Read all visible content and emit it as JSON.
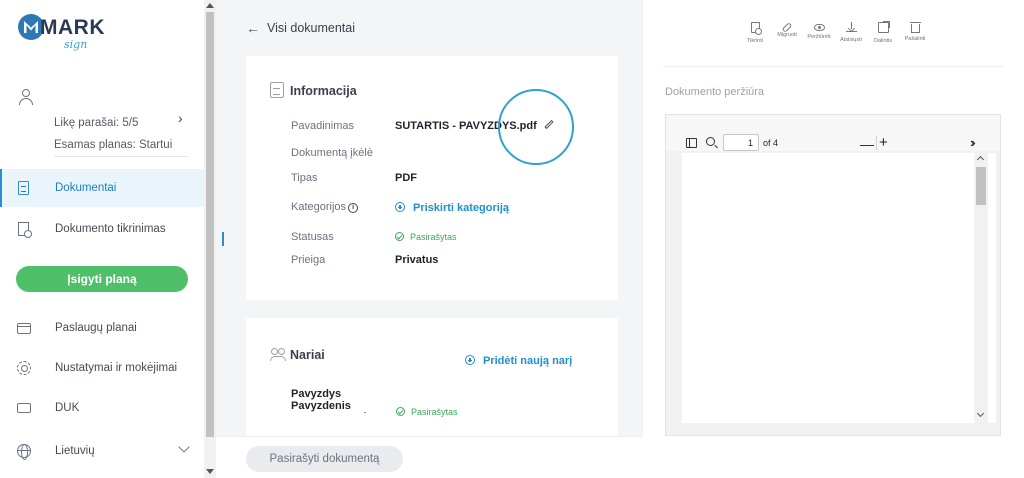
{
  "brand": {
    "word": "MARK",
    "sub": "sign"
  },
  "account": {
    "signatures_left": "Likę parašai: 5/5",
    "current_plan": "Esamas planas: Startui"
  },
  "nav": {
    "documents": "Dokumentai",
    "doc_check": "Dokumento tikrinimas",
    "buy_plan": "Įsigyti planą",
    "service_plans": "Paslaugų planai",
    "settings": "Nustatymai ir mokėjimai",
    "faq": "DUK",
    "language": "Lietuvių"
  },
  "header": {
    "back_title": "Visi dokumentai"
  },
  "info_card": {
    "title": "Informacija",
    "rows": {
      "name_label": "Pavadinimas",
      "name_value": "SUTARTIS - PAVYZDYS.pdf",
      "uploaded_label": "Dokumentą įkėlė",
      "uploaded_value": "",
      "type_label": "Tipas",
      "type_value": "PDF",
      "categories_label": "Kategorijos",
      "categories_action": "Priskirti kategoriją",
      "status_label": "Statusas",
      "status_value": "Pasirašytas",
      "access_label": "Prieiga",
      "access_value": "Privatus"
    }
  },
  "members_card": {
    "title": "Nariai",
    "add_action": "Pridėti naują narį",
    "members": [
      {
        "name_line1": "Pavyzdys",
        "name_line2": "Pavyzdenis",
        "status": "Pasirašytas"
      }
    ]
  },
  "bottom": {
    "sign_button": "Pasirašyti dokumentą"
  },
  "toolbar": {
    "check": "Tikrinti",
    "migrate": "Migruoti",
    "view": "Peržiūrėti",
    "download": "Atsisiųsti",
    "share": "Dalintis",
    "delete": "Pašalinti"
  },
  "preview": {
    "title": "Dokumento peržiūra",
    "page_input": "1",
    "page_of": "of 4"
  },
  "colors": {
    "accent": "#2b8fd1",
    "green": "#4fbf6a",
    "highlight": "#2ea3c9"
  }
}
